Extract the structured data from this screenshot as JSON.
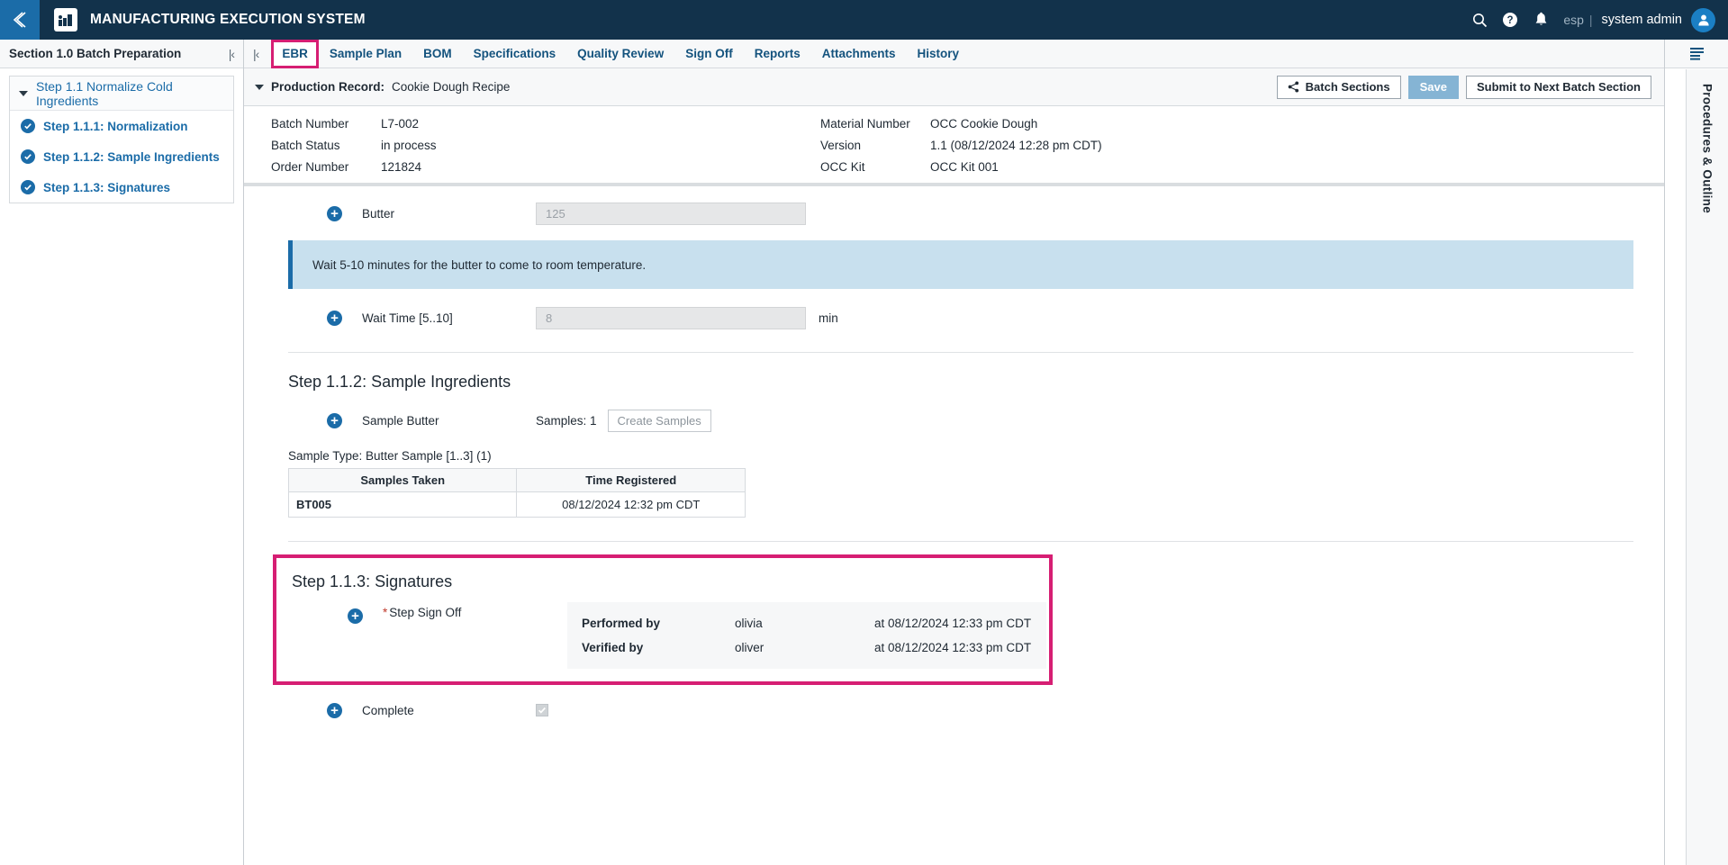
{
  "header": {
    "back_icon": "chevron-left-icon",
    "logo_icon": "factory-icon",
    "title": "MANUFACTURING EXECUTION SYSTEM",
    "search_icon": "search-icon",
    "help_icon": "help-circle-icon",
    "notifications_icon": "bell-icon",
    "language": "esp",
    "separator": "|",
    "user": "system admin",
    "avatar_icon": "user-avatar-icon"
  },
  "sidebar": {
    "title": "Section 1.0 Batch Preparation",
    "collapse_icon": "collapse-left-icon",
    "collapse_label": "|‹",
    "parent": {
      "label": "Step 1.1 Normalize Cold Ingredients",
      "caret_icon": "caret-down-icon"
    },
    "children": [
      {
        "label": "Step 1.1.1: Normalization",
        "status_icon": "check-circle-icon"
      },
      {
        "label": "Step 1.1.2: Sample Ingredients",
        "status_icon": "check-circle-icon"
      },
      {
        "label": "Step 1.1.3: Signatures",
        "status_icon": "check-circle-icon"
      }
    ]
  },
  "tabs": {
    "collapse_label": "|‹",
    "items": [
      {
        "label": "EBR",
        "active": true
      },
      {
        "label": "Sample Plan",
        "active": false
      },
      {
        "label": "BOM",
        "active": false
      },
      {
        "label": "Specifications",
        "active": false
      },
      {
        "label": "Quality Review",
        "active": false
      },
      {
        "label": "Sign Off",
        "active": false
      },
      {
        "label": "Reports",
        "active": false
      },
      {
        "label": "Attachments",
        "active": false
      },
      {
        "label": "History",
        "active": false
      }
    ]
  },
  "production_record": {
    "caret_icon": "caret-down-icon",
    "label": "Production Record:",
    "value": "Cookie Dough Recipe",
    "batch_sections_button": "Batch Sections",
    "batch_sections_icon": "share-icon",
    "save_button": "Save",
    "submit_button": "Submit to Next Batch Section"
  },
  "meta": {
    "left": [
      {
        "key": "Batch Number",
        "value": "L7-002"
      },
      {
        "key": "Batch Status",
        "value": "in process"
      },
      {
        "key": "Order Number",
        "value": "121824"
      }
    ],
    "right": [
      {
        "key": "Material Number",
        "value": "OCC Cookie Dough"
      },
      {
        "key": "Version",
        "value": "1.1 (08/12/2024 12:28 pm CDT)"
      },
      {
        "key": "OCC Kit",
        "value": "OCC Kit 001"
      }
    ]
  },
  "content": {
    "butter_field": {
      "label": "Butter",
      "value": "125",
      "add_icon": "plus-circle-icon"
    },
    "info_message": "Wait 5-10 minutes for the butter to come to room temperature.",
    "wait_time_field": {
      "label": "Wait Time [5..10]",
      "value": "8",
      "unit": "min",
      "add_icon": "plus-circle-icon"
    },
    "step_112": {
      "title": "Step 1.1.2: Sample Ingredients",
      "sample_butter_label": "Sample Butter",
      "add_icon": "plus-circle-icon",
      "samples_count_label": "Samples: 1",
      "create_samples_button": "Create Samples",
      "sample_type_label": "Sample Type: Butter Sample [1..3] (1)",
      "table": {
        "columns": [
          "Samples Taken",
          "Time Registered"
        ],
        "rows": [
          {
            "sample": "BT005",
            "time": "08/12/2024 12:32 pm CDT"
          }
        ]
      }
    },
    "step_113": {
      "title": "Step 1.1.3: Signatures",
      "sign_off_label": "Step Sign Off",
      "required_marker": "*",
      "add_icon": "plus-circle-icon",
      "signatures": [
        {
          "role": "Performed by",
          "user": "olivia",
          "time": "at 08/12/2024 12:33 pm CDT"
        },
        {
          "role": "Verified by",
          "user": "oliver",
          "time": "at 08/12/2024 12:33 pm CDT"
        }
      ]
    },
    "complete_field": {
      "label": "Complete",
      "add_icon": "plus-circle-icon",
      "checked": true
    }
  },
  "right_rail": {
    "menu_icon": "outline-menu-icon",
    "label": "Procedures & Outline"
  },
  "colors": {
    "header_bg": "#12324b",
    "accent_blue": "#1b6ca8",
    "highlight_pink": "#d61e73",
    "info_bg": "#c8e0ee",
    "save_disabled": "#85b4d4"
  }
}
